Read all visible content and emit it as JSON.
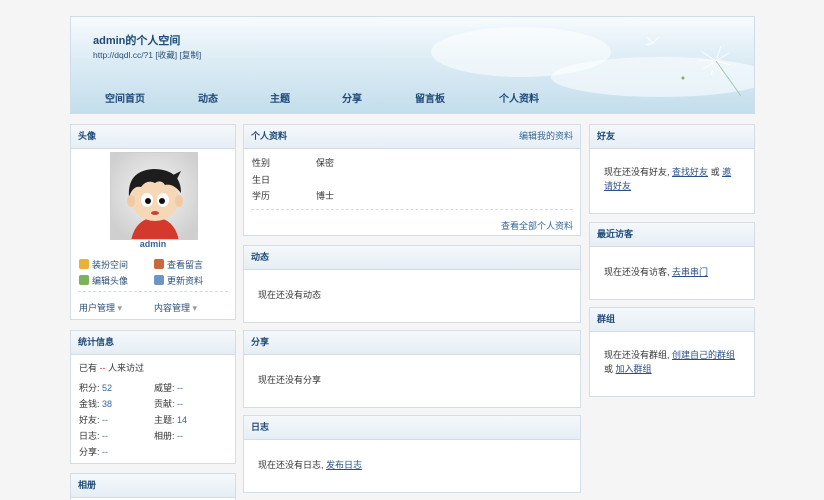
{
  "header": {
    "title": "admin的个人空间",
    "url_line": "http://dqdl.cc/?1 [收藏] [复制]",
    "nav": [
      "空间首页",
      "动态",
      "主题",
      "分享",
      "留言板",
      "个人资料"
    ]
  },
  "avatar_box": {
    "title": "头像",
    "username": "admin",
    "actions": [
      "装扮空间",
      "查看留言",
      "编辑头像",
      "更新资料"
    ],
    "menus": [
      "用户管理",
      "内容管理"
    ]
  },
  "stats": {
    "title": "统计信息",
    "visit_prefix": "已有",
    "visit_count": "--",
    "visit_suffix": "人来访过",
    "items": [
      {
        "label": "积分:",
        "value": "52"
      },
      {
        "label": "威望:",
        "value": "--"
      },
      {
        "label": "金钱:",
        "value": "38"
      },
      {
        "label": "贡献:",
        "value": "--"
      },
      {
        "label": "好友:",
        "value": "--"
      },
      {
        "label": "主题:",
        "value": "14"
      },
      {
        "label": "日志:",
        "value": "--"
      },
      {
        "label": "相册:",
        "value": "--"
      },
      {
        "label": "分享:",
        "value": "--"
      }
    ]
  },
  "album": {
    "title": "相册"
  },
  "profile": {
    "title": "个人资料",
    "edit": "编辑我的资料",
    "rows": [
      {
        "label": "性别",
        "value": "保密"
      },
      {
        "label": "生日",
        "value": ""
      },
      {
        "label": "学历",
        "value": "博士"
      }
    ],
    "view_all": "查看全部个人资料"
  },
  "feed": {
    "title": "动态",
    "empty": "现在还没有动态"
  },
  "share": {
    "title": "分享",
    "empty": "现在还没有分享"
  },
  "blog": {
    "title": "日志",
    "empty": "现在还没有日志,",
    "link": "发布日志"
  },
  "friends": {
    "title": "好友",
    "text": "现在还没有好友,",
    "link1": "查找好友",
    "or": "或",
    "link2": "邀请好友"
  },
  "visitors": {
    "title": "最近访客",
    "text": "现在还没有访客,",
    "link": "去串串门"
  },
  "groups": {
    "title": "群组",
    "text": "现在还没有群组,",
    "link1": "创建自己的群组",
    "or": "或",
    "link2": "加入群组"
  }
}
